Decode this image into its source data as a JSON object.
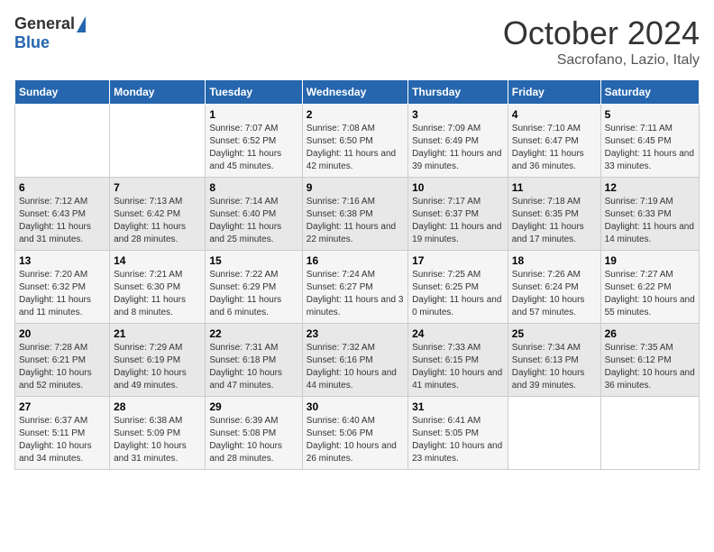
{
  "header": {
    "logo_general": "General",
    "logo_blue": "Blue",
    "month": "October 2024",
    "location": "Sacrofano, Lazio, Italy"
  },
  "columns": [
    "Sunday",
    "Monday",
    "Tuesday",
    "Wednesday",
    "Thursday",
    "Friday",
    "Saturday"
  ],
  "weeks": [
    [
      {
        "day": "",
        "sunrise": "",
        "sunset": "",
        "daylight": ""
      },
      {
        "day": "",
        "sunrise": "",
        "sunset": "",
        "daylight": ""
      },
      {
        "day": "1",
        "sunrise": "Sunrise: 7:07 AM",
        "sunset": "Sunset: 6:52 PM",
        "daylight": "Daylight: 11 hours and 45 minutes."
      },
      {
        "day": "2",
        "sunrise": "Sunrise: 7:08 AM",
        "sunset": "Sunset: 6:50 PM",
        "daylight": "Daylight: 11 hours and 42 minutes."
      },
      {
        "day": "3",
        "sunrise": "Sunrise: 7:09 AM",
        "sunset": "Sunset: 6:49 PM",
        "daylight": "Daylight: 11 hours and 39 minutes."
      },
      {
        "day": "4",
        "sunrise": "Sunrise: 7:10 AM",
        "sunset": "Sunset: 6:47 PM",
        "daylight": "Daylight: 11 hours and 36 minutes."
      },
      {
        "day": "5",
        "sunrise": "Sunrise: 7:11 AM",
        "sunset": "Sunset: 6:45 PM",
        "daylight": "Daylight: 11 hours and 33 minutes."
      }
    ],
    [
      {
        "day": "6",
        "sunrise": "Sunrise: 7:12 AM",
        "sunset": "Sunset: 6:43 PM",
        "daylight": "Daylight: 11 hours and 31 minutes."
      },
      {
        "day": "7",
        "sunrise": "Sunrise: 7:13 AM",
        "sunset": "Sunset: 6:42 PM",
        "daylight": "Daylight: 11 hours and 28 minutes."
      },
      {
        "day": "8",
        "sunrise": "Sunrise: 7:14 AM",
        "sunset": "Sunset: 6:40 PM",
        "daylight": "Daylight: 11 hours and 25 minutes."
      },
      {
        "day": "9",
        "sunrise": "Sunrise: 7:16 AM",
        "sunset": "Sunset: 6:38 PM",
        "daylight": "Daylight: 11 hours and 22 minutes."
      },
      {
        "day": "10",
        "sunrise": "Sunrise: 7:17 AM",
        "sunset": "Sunset: 6:37 PM",
        "daylight": "Daylight: 11 hours and 19 minutes."
      },
      {
        "day": "11",
        "sunrise": "Sunrise: 7:18 AM",
        "sunset": "Sunset: 6:35 PM",
        "daylight": "Daylight: 11 hours and 17 minutes."
      },
      {
        "day": "12",
        "sunrise": "Sunrise: 7:19 AM",
        "sunset": "Sunset: 6:33 PM",
        "daylight": "Daylight: 11 hours and 14 minutes."
      }
    ],
    [
      {
        "day": "13",
        "sunrise": "Sunrise: 7:20 AM",
        "sunset": "Sunset: 6:32 PM",
        "daylight": "Daylight: 11 hours and 11 minutes."
      },
      {
        "day": "14",
        "sunrise": "Sunrise: 7:21 AM",
        "sunset": "Sunset: 6:30 PM",
        "daylight": "Daylight: 11 hours and 8 minutes."
      },
      {
        "day": "15",
        "sunrise": "Sunrise: 7:22 AM",
        "sunset": "Sunset: 6:29 PM",
        "daylight": "Daylight: 11 hours and 6 minutes."
      },
      {
        "day": "16",
        "sunrise": "Sunrise: 7:24 AM",
        "sunset": "Sunset: 6:27 PM",
        "daylight": "Daylight: 11 hours and 3 minutes."
      },
      {
        "day": "17",
        "sunrise": "Sunrise: 7:25 AM",
        "sunset": "Sunset: 6:25 PM",
        "daylight": "Daylight: 11 hours and 0 minutes."
      },
      {
        "day": "18",
        "sunrise": "Sunrise: 7:26 AM",
        "sunset": "Sunset: 6:24 PM",
        "daylight": "Daylight: 10 hours and 57 minutes."
      },
      {
        "day": "19",
        "sunrise": "Sunrise: 7:27 AM",
        "sunset": "Sunset: 6:22 PM",
        "daylight": "Daylight: 10 hours and 55 minutes."
      }
    ],
    [
      {
        "day": "20",
        "sunrise": "Sunrise: 7:28 AM",
        "sunset": "Sunset: 6:21 PM",
        "daylight": "Daylight: 10 hours and 52 minutes."
      },
      {
        "day": "21",
        "sunrise": "Sunrise: 7:29 AM",
        "sunset": "Sunset: 6:19 PM",
        "daylight": "Daylight: 10 hours and 49 minutes."
      },
      {
        "day": "22",
        "sunrise": "Sunrise: 7:31 AM",
        "sunset": "Sunset: 6:18 PM",
        "daylight": "Daylight: 10 hours and 47 minutes."
      },
      {
        "day": "23",
        "sunrise": "Sunrise: 7:32 AM",
        "sunset": "Sunset: 6:16 PM",
        "daylight": "Daylight: 10 hours and 44 minutes."
      },
      {
        "day": "24",
        "sunrise": "Sunrise: 7:33 AM",
        "sunset": "Sunset: 6:15 PM",
        "daylight": "Daylight: 10 hours and 41 minutes."
      },
      {
        "day": "25",
        "sunrise": "Sunrise: 7:34 AM",
        "sunset": "Sunset: 6:13 PM",
        "daylight": "Daylight: 10 hours and 39 minutes."
      },
      {
        "day": "26",
        "sunrise": "Sunrise: 7:35 AM",
        "sunset": "Sunset: 6:12 PM",
        "daylight": "Daylight: 10 hours and 36 minutes."
      }
    ],
    [
      {
        "day": "27",
        "sunrise": "Sunrise: 6:37 AM",
        "sunset": "Sunset: 5:11 PM",
        "daylight": "Daylight: 10 hours and 34 minutes."
      },
      {
        "day": "28",
        "sunrise": "Sunrise: 6:38 AM",
        "sunset": "Sunset: 5:09 PM",
        "daylight": "Daylight: 10 hours and 31 minutes."
      },
      {
        "day": "29",
        "sunrise": "Sunrise: 6:39 AM",
        "sunset": "Sunset: 5:08 PM",
        "daylight": "Daylight: 10 hours and 28 minutes."
      },
      {
        "day": "30",
        "sunrise": "Sunrise: 6:40 AM",
        "sunset": "Sunset: 5:06 PM",
        "daylight": "Daylight: 10 hours and 26 minutes."
      },
      {
        "day": "31",
        "sunrise": "Sunrise: 6:41 AM",
        "sunset": "Sunset: 5:05 PM",
        "daylight": "Daylight: 10 hours and 23 minutes."
      },
      {
        "day": "",
        "sunrise": "",
        "sunset": "",
        "daylight": ""
      },
      {
        "day": "",
        "sunrise": "",
        "sunset": "",
        "daylight": ""
      }
    ]
  ]
}
